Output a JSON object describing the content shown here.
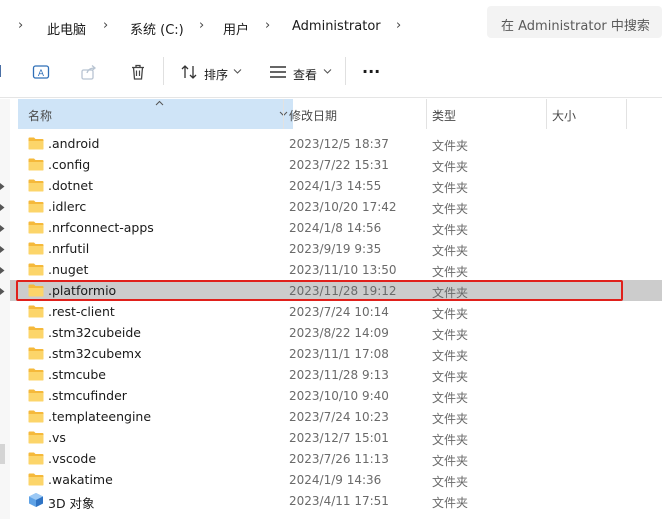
{
  "address": {
    "crumbs": [
      "此电脑",
      "系统 (C:)",
      "用户",
      "Administrator"
    ],
    "separator": "›",
    "search_placeholder": "在 Administrator 中搜索"
  },
  "toolbar": {
    "sort_label": "排序",
    "view_label": "查看",
    "more_label": "···"
  },
  "columns": {
    "name": "名称",
    "modified": "修改日期",
    "type": "类型",
    "size": "大小"
  },
  "files": [
    {
      "name": ".android",
      "date": "2023/12/5 18:37",
      "type": "文件夹"
    },
    {
      "name": ".config",
      "date": "2023/7/22 15:31",
      "type": "文件夹"
    },
    {
      "name": ".dotnet",
      "date": "2024/1/3 14:55",
      "type": "文件夹"
    },
    {
      "name": ".idlerc",
      "date": "2023/10/20 17:42",
      "type": "文件夹"
    },
    {
      "name": ".nrfconnect-apps",
      "date": "2024/1/8 14:56",
      "type": "文件夹"
    },
    {
      "name": ".nrfutil",
      "date": "2023/9/19 9:35",
      "type": "文件夹"
    },
    {
      "name": ".nuget",
      "date": "2023/11/10 13:50",
      "type": "文件夹"
    },
    {
      "name": ".platformio",
      "date": "2023/11/28 19:12",
      "type": "文件夹",
      "selected": true
    },
    {
      "name": ".rest-client",
      "date": "2023/7/24 10:14",
      "type": "文件夹"
    },
    {
      "name": ".stm32cubeide",
      "date": "2023/8/22 14:09",
      "type": "文件夹"
    },
    {
      "name": ".stm32cubemx",
      "date": "2023/11/1 17:08",
      "type": "文件夹"
    },
    {
      "name": ".stmcube",
      "date": "2023/11/28 9:13",
      "type": "文件夹"
    },
    {
      "name": ".stmcufinder",
      "date": "2023/10/10 9:40",
      "type": "文件夹"
    },
    {
      "name": ".templateengine",
      "date": "2023/7/24 10:23",
      "type": "文件夹"
    },
    {
      "name": ".vs",
      "date": "2023/12/7 15:01",
      "type": "文件夹"
    },
    {
      "name": ".vscode",
      "date": "2023/7/26 11:13",
      "type": "文件夹"
    },
    {
      "name": ".wakatime",
      "date": "2024/1/9 14:36",
      "type": "文件夹"
    },
    {
      "name": "3D 对象",
      "date": "2023/4/11 17:51",
      "type": "文件夹",
      "icon": "3d-objects-icon"
    }
  ],
  "colors": {
    "folder": "#f8c84a",
    "selection": "#cccccc",
    "highlight": "#e0201b",
    "header_active": "#cfe4f7"
  }
}
